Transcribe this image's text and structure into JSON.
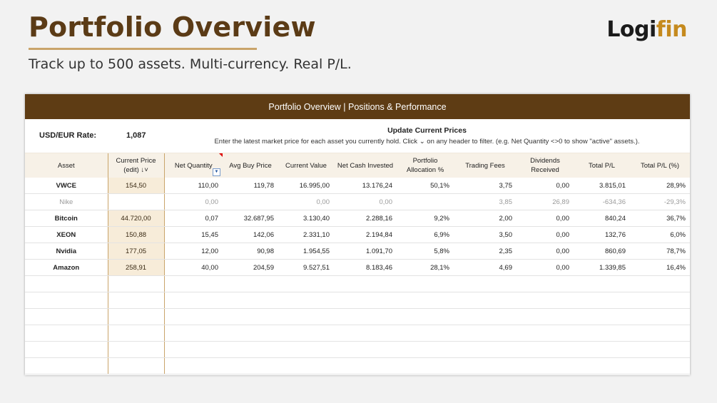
{
  "header": {
    "title": "Portfolio Overview",
    "subtitle": "Track up to 500 assets. Multi-currency. Real P/L.",
    "logo_part1": "Logi",
    "logo_part2": "fin"
  },
  "sheet": {
    "banner": "Portfolio Overview | Positions & Performance",
    "usd_eur_label": "USD/EUR Rate:",
    "usd_eur_value": "1,087",
    "update_title": "Update Current Prices",
    "update_desc": "Enter the latest market price for each asset you currently hold. Click ⌄ on any header to filter. (e.g. Net Quantity <>0 to show \"active\" assets.)."
  },
  "table": {
    "columns": [
      "Asset",
      "Current Price (edit) ↓˅",
      "Net Quantity",
      "Avg Buy Price",
      "Current Value",
      "Net Cash Invested",
      "Portfolio Allocation %",
      "Trading Fees",
      "Dividends Received",
      "Total P/L",
      "Total P/L (%)"
    ],
    "rows": [
      {
        "asset": "VWCE",
        "price": "154,50",
        "qty": "110,00",
        "avg": "119,78",
        "value": "16.995,00",
        "cash": "13.176,24",
        "alloc": "50,1%",
        "fees": "3,75",
        "div": "0,00",
        "pl": "3.815,01",
        "plpct": "28,9%"
      },
      {
        "asset": "Nike",
        "price": "",
        "qty": "0,00",
        "avg": "",
        "value": "0,00",
        "cash": "0,00",
        "alloc": "",
        "fees": "3,85",
        "div": "26,89",
        "pl": "-634,36",
        "plpct": "-29,3%"
      },
      {
        "asset": "Bitcoin",
        "price": "44.720,00",
        "qty": "0,07",
        "avg": "32.687,95",
        "value": "3.130,40",
        "cash": "2.288,16",
        "alloc": "9,2%",
        "fees": "2,00",
        "div": "0,00",
        "pl": "840,24",
        "plpct": "36,7%"
      },
      {
        "asset": "XEON",
        "price": "150,88",
        "qty": "15,45",
        "avg": "142,06",
        "value": "2.331,10",
        "cash": "2.194,84",
        "alloc": "6,9%",
        "fees": "3,50",
        "div": "0,00",
        "pl": "132,76",
        "plpct": "6,0%"
      },
      {
        "asset": "Nvidia",
        "price": "177,05",
        "qty": "12,00",
        "avg": "90,98",
        "value": "1.954,55",
        "cash": "1.091,70",
        "alloc": "5,8%",
        "fees": "2,35",
        "div": "0,00",
        "pl": "860,69",
        "plpct": "78,7%"
      },
      {
        "asset": "Amazon",
        "price": "258,91",
        "qty": "40,00",
        "avg": "204,59",
        "value": "9.527,51",
        "cash": "8.183,46",
        "alloc": "28,1%",
        "fees": "4,69",
        "div": "0,00",
        "pl": "1.339,85",
        "plpct": "16,4%"
      }
    ]
  },
  "colors": {
    "brown": "#5e3c14",
    "gold": "#c9a46a",
    "positive": "#2e7d32",
    "logo_accent": "#c58a1e"
  }
}
